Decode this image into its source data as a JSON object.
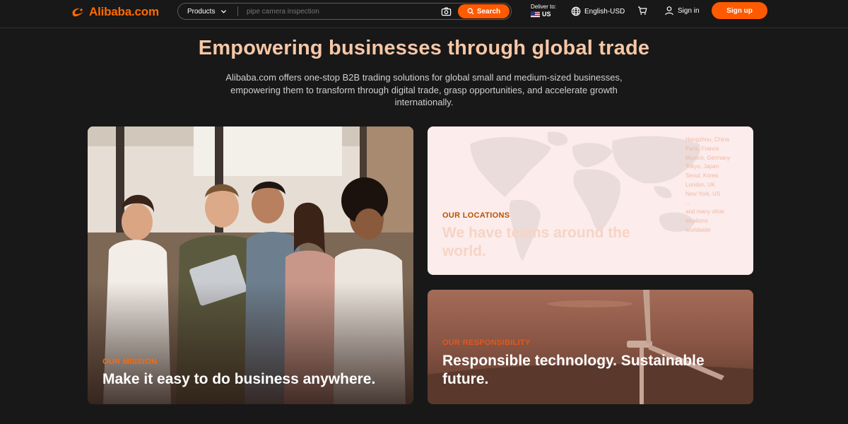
{
  "header": {
    "logo_text": "Alibaba.com",
    "products_label": "Products",
    "search_placeholder": "pipe camera inspection",
    "search_button": "Search",
    "deliver_label": "Deliver to:",
    "deliver_country": "US",
    "language_currency": "English-USD",
    "signin_label": "Sign in",
    "signup_label": "Sign up",
    "accent_color": "#ff6a00",
    "icons": [
      "chevron-down-icon",
      "camera-icon",
      "search-icon",
      "us-flag-icon",
      "globe-icon",
      "cart-icon",
      "user-icon"
    ]
  },
  "hero": {
    "title": "Empowering businesses through global trade",
    "description": "Alibaba.com offers one-stop B2B trading solutions for global small and medium-sized businesses, empowering them to transform through digital trade, grasp opportunities, and accelerate growth internationally."
  },
  "cards": {
    "mission": {
      "eyebrow": "OUR MISSION",
      "title": "Make it easy to do business anywhere."
    },
    "locations": {
      "eyebrow": "OUR LOCATIONS",
      "title": "We have teams around the world.",
      "locations": [
        "Hangzhou, China",
        "Paris, France",
        "Munich, Germany",
        "Tokyo, Japan",
        "Seoul, Korea",
        "London, UK",
        "New York, US",
        "...",
        "and many other",
        "locations",
        "worldwide"
      ]
    },
    "responsibility": {
      "eyebrow": "OUR RESPONSIBILITY",
      "title": "Responsible technology. Sustainable future."
    }
  }
}
